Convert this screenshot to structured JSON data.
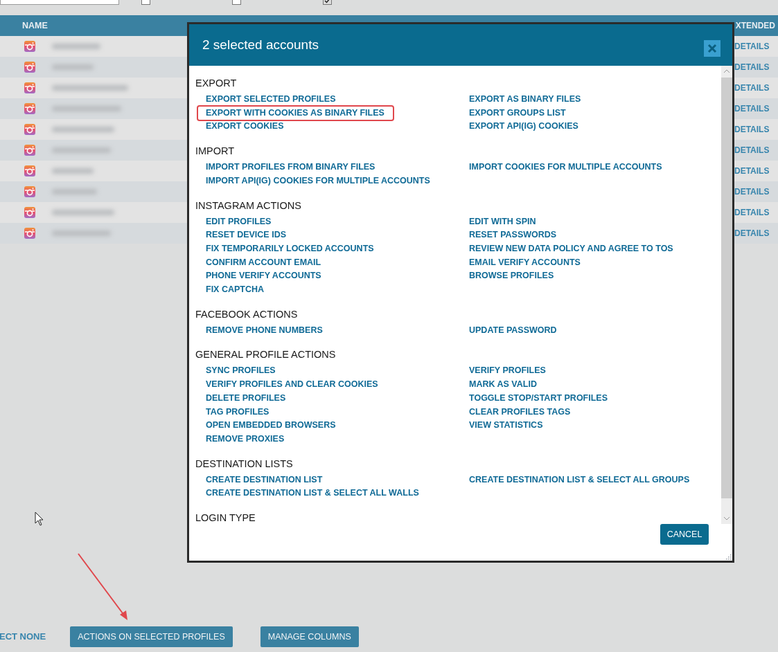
{
  "toolbar": {
    "checkboxes": [
      {
        "checked": false
      },
      {
        "checked": false
      },
      {
        "checked": true
      }
    ]
  },
  "table": {
    "columns": [
      {
        "label": "NAME"
      },
      {
        "label": "XTENDED"
      }
    ],
    "rows": [
      {
        "details": "DETAILS"
      },
      {
        "details": "DETAILS"
      },
      {
        "details": "DETAILS"
      },
      {
        "details": "DETAILS"
      },
      {
        "details": "DETAILS"
      },
      {
        "details": "DETAILS"
      },
      {
        "details": "DETAILS"
      },
      {
        "details": "DETAILS"
      },
      {
        "details": "DETAILS"
      },
      {
        "details": "DETAILS"
      }
    ]
  },
  "footer": {
    "select_none": "ECT NONE",
    "buttons": [
      "ACTIONS ON SELECTED PROFILES",
      "MANAGE COLUMNS"
    ]
  },
  "dialog": {
    "title": "2 selected accounts",
    "cancel": "CANCEL",
    "sections": [
      {
        "title": "EXPORT",
        "rows": [
          [
            {
              "label": "EXPORT SELECTED PROFILES",
              "highlighted": false
            },
            {
              "label": "EXPORT AS BINARY FILES",
              "highlighted": false
            }
          ],
          [
            {
              "label": "EXPORT WITH COOKIES AS BINARY FILES",
              "highlighted": true
            },
            {
              "label": "EXPORT GROUPS LIST",
              "highlighted": false
            }
          ],
          [
            {
              "label": "EXPORT COOKIES",
              "highlighted": false
            },
            {
              "label": "EXPORT API(IG) COOKIES",
              "highlighted": false
            }
          ]
        ]
      },
      {
        "title": "IMPORT",
        "rows": [
          [
            {
              "label": "IMPORT PROFILES FROM BINARY FILES",
              "highlighted": false
            },
            {
              "label": "IMPORT COOKIES FOR MULTIPLE ACCOUNTS",
              "highlighted": false
            }
          ],
          [
            {
              "label": "IMPORT API(IG) COOKIES FOR MULTIPLE ACCOUNTS",
              "highlighted": false
            }
          ]
        ]
      },
      {
        "title": "INSTAGRAM ACTIONS",
        "rows": [
          [
            {
              "label": "EDIT PROFILES",
              "highlighted": false
            },
            {
              "label": "EDIT WITH SPIN",
              "highlighted": false
            }
          ],
          [
            {
              "label": "RESET DEVICE IDS",
              "highlighted": false
            },
            {
              "label": "RESET PASSWORDS",
              "highlighted": false
            }
          ],
          [
            {
              "label": "FIX TEMPORARILY LOCKED ACCOUNTS",
              "highlighted": false
            },
            {
              "label": "REVIEW NEW DATA POLICY AND AGREE TO TOS",
              "highlighted": false
            }
          ],
          [
            {
              "label": "CONFIRM ACCOUNT EMAIL",
              "highlighted": false
            },
            {
              "label": "EMAIL VERIFY ACCOUNTS",
              "highlighted": false
            }
          ],
          [
            {
              "label": "PHONE VERIFY ACCOUNTS",
              "highlighted": false
            },
            {
              "label": "BROWSE PROFILES",
              "highlighted": false
            }
          ],
          [
            {
              "label": "FIX CAPTCHA",
              "highlighted": false
            }
          ]
        ]
      },
      {
        "title": "FACEBOOK ACTIONS",
        "rows": [
          [
            {
              "label": "REMOVE PHONE NUMBERS",
              "highlighted": false
            },
            {
              "label": "UPDATE PASSWORD",
              "highlighted": false
            }
          ]
        ]
      },
      {
        "title": "GENERAL PROFILE ACTIONS",
        "rows": [
          [
            {
              "label": "SYNC PROFILES",
              "highlighted": false
            },
            {
              "label": "VERIFY PROFILES",
              "highlighted": false
            }
          ],
          [
            {
              "label": "VERIFY PROFILES AND CLEAR COOKIES",
              "highlighted": false
            },
            {
              "label": "MARK AS VALID",
              "highlighted": false
            }
          ],
          [
            {
              "label": "DELETE PROFILES",
              "highlighted": false
            },
            {
              "label": "TOGGLE STOP/START PROFILES",
              "highlighted": false
            }
          ],
          [
            {
              "label": "TAG PROFILES",
              "highlighted": false
            },
            {
              "label": "CLEAR PROFILES TAGS",
              "highlighted": false
            }
          ],
          [
            {
              "label": "OPEN EMBEDDED BROWSERS",
              "highlighted": false
            },
            {
              "label": "VIEW STATISTICS",
              "highlighted": false
            }
          ],
          [
            {
              "label": "REMOVE PROXIES",
              "highlighted": false
            }
          ]
        ]
      },
      {
        "title": "DESTINATION LISTS",
        "rows": [
          [
            {
              "label": "CREATE DESTINATION LIST",
              "highlighted": false
            },
            {
              "label": "CREATE DESTINATION LIST & SELECT ALL GROUPS",
              "highlighted": false
            }
          ],
          [
            {
              "label": "CREATE DESTINATION LIST & SELECT ALL WALLS",
              "highlighted": false
            }
          ]
        ]
      },
      {
        "title": "LOGIN TYPE"
      }
    ]
  }
}
